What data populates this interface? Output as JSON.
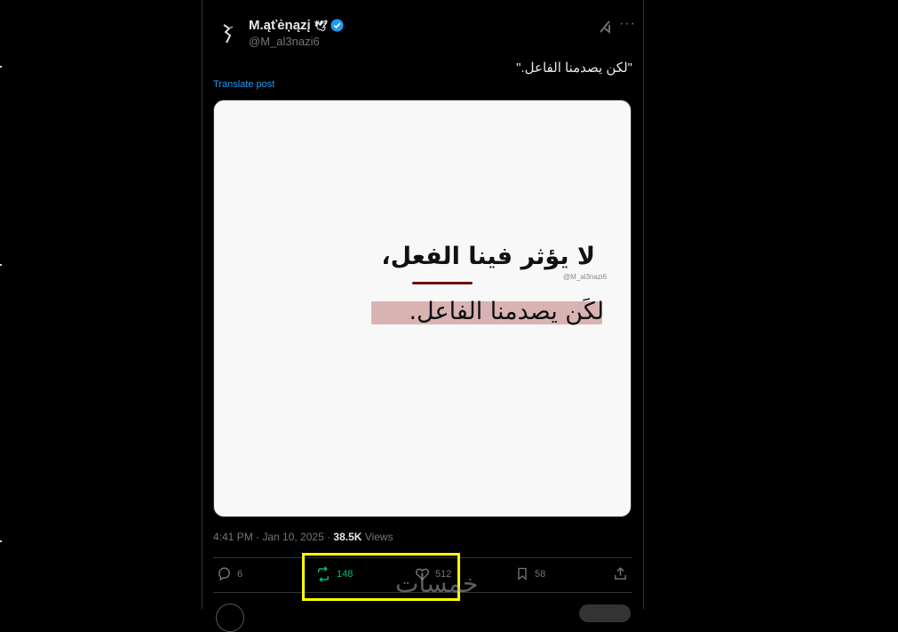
{
  "post": {
    "author_name": "M.ąťėņązį",
    "author_bird": "🕊",
    "author_handle": "@M_al3nazi6",
    "text": "\"لكن يصدمنا الفاعل.\"",
    "translate_label": "Translate post",
    "timestamp": "4:41 PM · Jan 10, 2025 · ",
    "views_count": "38.5K",
    "views_label": " Views"
  },
  "image": {
    "line1": "لا يؤثر فينا الفعل،",
    "line2": "لكَن يصدمنا الفاعل.",
    "watermark": "@M_al3nazi6"
  },
  "actions": {
    "replies": "6",
    "reposts": "148",
    "likes": "512",
    "bookmarks": "58"
  },
  "overlay": {
    "site_watermark": "خمسات"
  },
  "colors": {
    "accent": "#1d9bf0",
    "repost_active": "#00ba7c",
    "highlight_box": "#ffff00"
  },
  "icons": [
    "verified-badge-icon",
    "grok-icon",
    "more-icon",
    "reply-icon",
    "repost-icon",
    "like-icon",
    "bookmark-icon",
    "share-icon"
  ]
}
